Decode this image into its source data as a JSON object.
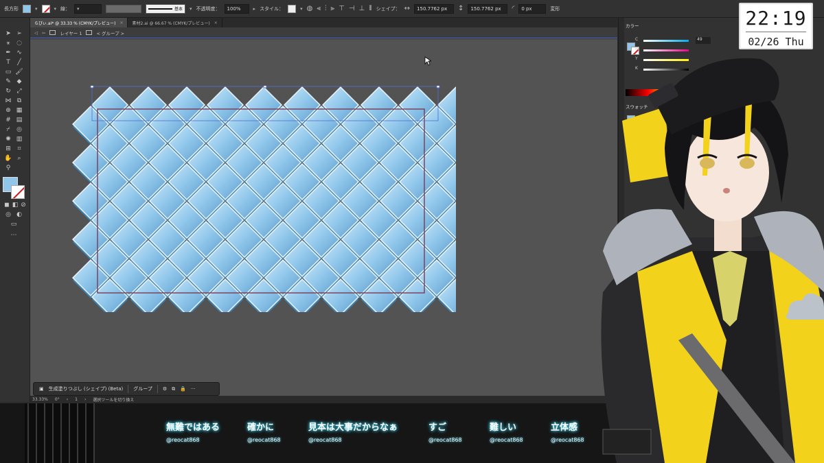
{
  "control_bar": {
    "shape_label": "長方形",
    "stroke_label": "線：",
    "stroke_style": "基本",
    "opacity_label": "不透明度：",
    "opacity_value": "100%",
    "style_label": "スタイル：",
    "shape_section_label": "シェイプ：",
    "width_value": "150.7762 px",
    "height_value": "150.7762 px",
    "corner_value": "0 px",
    "transform_label": "変形"
  },
  "tabs": [
    {
      "label": "らびぃ.ai* @ 33.33 % (CMYK/プレビュー)",
      "close": "×"
    },
    {
      "label": "素材2.ai @ 66.67 % (CMYK/プレビュー)",
      "close": "×"
    }
  ],
  "breadcrumb": {
    "layer": "レイヤー 1",
    "group": "< グループ >"
  },
  "context_bar": {
    "generate_label": "生成塗りつぶし (シェイプ) (Beta)",
    "group_label": "グループ",
    "more": "···"
  },
  "status_bar": {
    "zoom": "33.33%",
    "rotation": "0°",
    "artboard": "1",
    "tool_hint": "選択ツールを切り換え"
  },
  "right_panel": {
    "color_header": "カラー",
    "c_label": "C",
    "m_label": "M",
    "y_label": "Y",
    "k_label": "K",
    "c_value": "49",
    "swatches_header": "スウォッチ"
  },
  "clock": {
    "time": "22:19",
    "date": "02/26 Thu"
  },
  "chat": [
    {
      "text": "無難ではある",
      "user": "@reocat868"
    },
    {
      "text": "確かに",
      "user": "@reocat868"
    },
    {
      "text": "見本は大事だからなぁ",
      "user": "@reocat868"
    },
    {
      "text": "すご",
      "user": "@reocat868"
    },
    {
      "text": "難しい",
      "user": "@reocat868"
    },
    {
      "text": "立体感",
      "user": "@reocat868"
    }
  ],
  "colors": {
    "tile_fill": "#8fc6ea",
    "tile_shadow": "#3f7fae",
    "selection_blue": "#4e6fd8",
    "chat_glow": "#4fe3ff"
  },
  "icons": [
    "selection-tool-icon",
    "pen-tool-icon",
    "type-tool-icon",
    "rectangle-tool-icon",
    "brush-tool-icon",
    "eraser-tool-icon",
    "zoom-tool-icon",
    "hand-tool-icon"
  ]
}
